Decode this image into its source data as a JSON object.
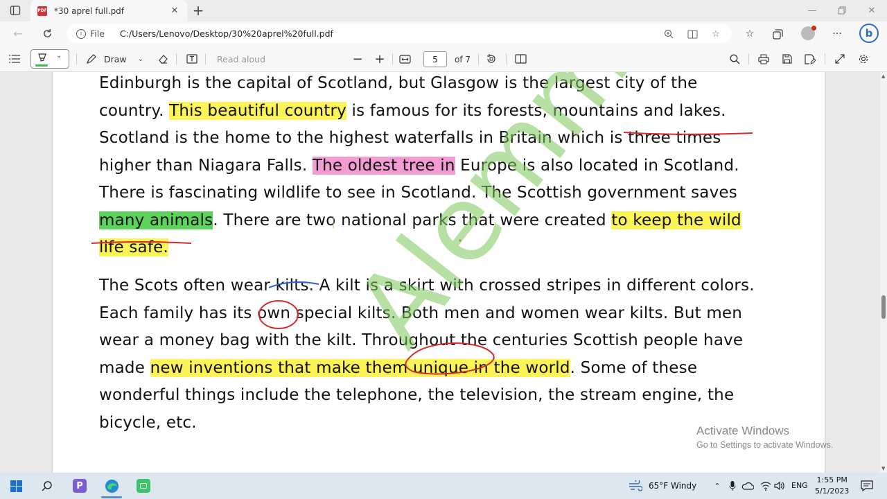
{
  "browser": {
    "tab_title": "*30 aprel full.pdf",
    "new_tab": "+",
    "file_label": "File",
    "url": "C:/Users/Lenovo/Desktop/30%20aprel%20full.pdf"
  },
  "pdf_toolbar": {
    "draw_label": "Draw",
    "read_aloud_label": "Read aloud",
    "page_number": "5",
    "page_of": "of 7",
    "highlight_color": "#3fb74a"
  },
  "document": {
    "paragraph1": [
      {
        "parts": [
          {
            "text": "Edinburgh is the capital of Scotland, but Glasgow is the largest city of the",
            "hl": ""
          }
        ]
      },
      {
        "parts": [
          {
            "text": "country. ",
            "hl": ""
          },
          {
            "text": "This beautiful country",
            "hl": "y"
          },
          {
            "text": " is famous for its forests, mountains and lakes.",
            "hl": ""
          }
        ]
      },
      {
        "parts": [
          {
            "text": "Scotland is the home to the highest waterfalls in Britain which is three times",
            "hl": ""
          }
        ]
      },
      {
        "parts": [
          {
            "text": "higher than Niagara Falls. ",
            "hl": ""
          },
          {
            "text": "The oldest tree in",
            "hl": "p"
          },
          {
            "text": " Europe is also located in Scotland.",
            "hl": ""
          }
        ]
      },
      {
        "parts": [
          {
            "text": "There is fascinating wildlife to see in Scotland. The Scottish government saves",
            "hl": ""
          }
        ]
      },
      {
        "parts": [
          {
            "text": "many animals",
            "hl": "g"
          },
          {
            "text": ". There are two national parks that were created ",
            "hl": ""
          },
          {
            "text": "to keep the wild",
            "hl": "y"
          }
        ]
      },
      {
        "parts": [
          {
            "text": "life safe. ",
            "hl": "y"
          }
        ]
      }
    ],
    "paragraph2": [
      {
        "parts": [
          {
            "text": "The Scots often wear kilts. A kilt is a skirt with crossed stripes in different colors.",
            "hl": ""
          }
        ]
      },
      {
        "parts": [
          {
            "text": "Each family has its own special kilts. Both men and women wear kilts. But men",
            "hl": ""
          }
        ]
      },
      {
        "parts": [
          {
            "text": "wear a money bag with the kilt. Throughout the centuries Scottish people have",
            "hl": ""
          }
        ]
      },
      {
        "parts": [
          {
            "text": "made ",
            "hl": ""
          },
          {
            "text": "new inventions that make them unique in the world",
            "hl": "y"
          },
          {
            "text": ". Some of these",
            "hl": ""
          }
        ]
      },
      {
        "parts": [
          {
            "text": "wonderful things include the telephone, the television, the stream engine, the",
            "hl": ""
          }
        ]
      },
      {
        "parts": [
          {
            "text": "bicycle, etc.",
            "hl": ""
          }
        ]
      }
    ],
    "watermark": "Alemmedova"
  },
  "activation": {
    "title": "Activate Windows",
    "subtitle": "Go to Settings to activate Windows."
  },
  "taskbar": {
    "weather": "65°F  Windy",
    "language": "ENG",
    "time": "1:55 PM",
    "date": "5/1/2023"
  },
  "colors": {
    "highlight_yellow": "#fcf357",
    "highlight_pink": "#f39bd3",
    "highlight_green": "#5cd35a",
    "ink_red": "#d42a2a",
    "ink_blue": "#2b5fd9"
  }
}
